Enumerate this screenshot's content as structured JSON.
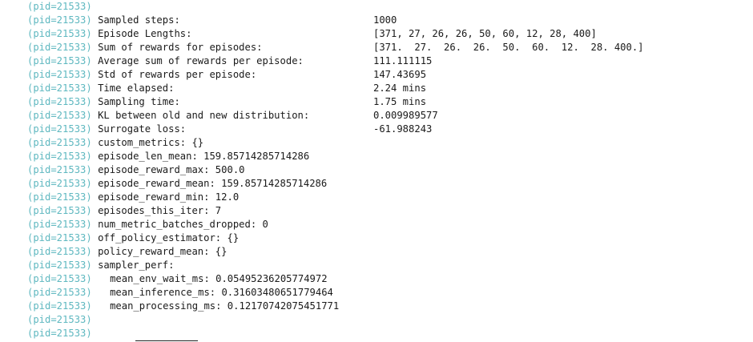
{
  "pid_prefix": "(pid=21533)",
  "lines": [
    {
      "label": "",
      "value": ""
    },
    {
      "label": "Sampled steps:",
      "value": "1000"
    },
    {
      "label": "Episode Lengths:",
      "value": "[371, 27, 26, 26, 50, 60, 12, 28, 400]"
    },
    {
      "label": "Sum of rewards for episodes:",
      "value": "[371.  27.  26.  26.  50.  60.  12.  28. 400.]"
    },
    {
      "label": "Average sum of rewards per episode:",
      "value": "111.111115"
    },
    {
      "label": "Std of rewards per episode:",
      "value": "147.43695"
    },
    {
      "label": "Time elapsed:",
      "value": "2.24 mins"
    },
    {
      "label": "Sampling time:",
      "value": "1.75 mins"
    },
    {
      "label": "KL between old and new distribution:",
      "value": "0.009989577"
    },
    {
      "label": "Surrogate loss:",
      "value": "-61.988243"
    },
    {
      "label": "custom_metrics: {}",
      "value": ""
    },
    {
      "label": "episode_len_mean: 159.85714285714286",
      "value": ""
    },
    {
      "label": "episode_reward_max: 500.0",
      "value": ""
    },
    {
      "label": "episode_reward_mean: 159.85714285714286",
      "value": ""
    },
    {
      "label": "episode_reward_min: 12.0",
      "value": ""
    },
    {
      "label": "episodes_this_iter: 7",
      "value": ""
    },
    {
      "label": "num_metric_batches_dropped: 0",
      "value": ""
    },
    {
      "label": "off_policy_estimator: {}",
      "value": ""
    },
    {
      "label": "policy_reward_mean: {}",
      "value": ""
    },
    {
      "label": "sampler_perf:",
      "value": ""
    },
    {
      "label": "mean_env_wait_ms: 0.05495236205774972",
      "value": "",
      "indent": true
    },
    {
      "label": "mean_inference_ms: 0.31603480651779464",
      "value": "",
      "indent": true
    },
    {
      "label": "mean_processing_ms: 0.12170742075451771",
      "value": "",
      "indent": true
    },
    {
      "label": "",
      "value": ""
    },
    {
      "label": "",
      "value": ""
    }
  ]
}
